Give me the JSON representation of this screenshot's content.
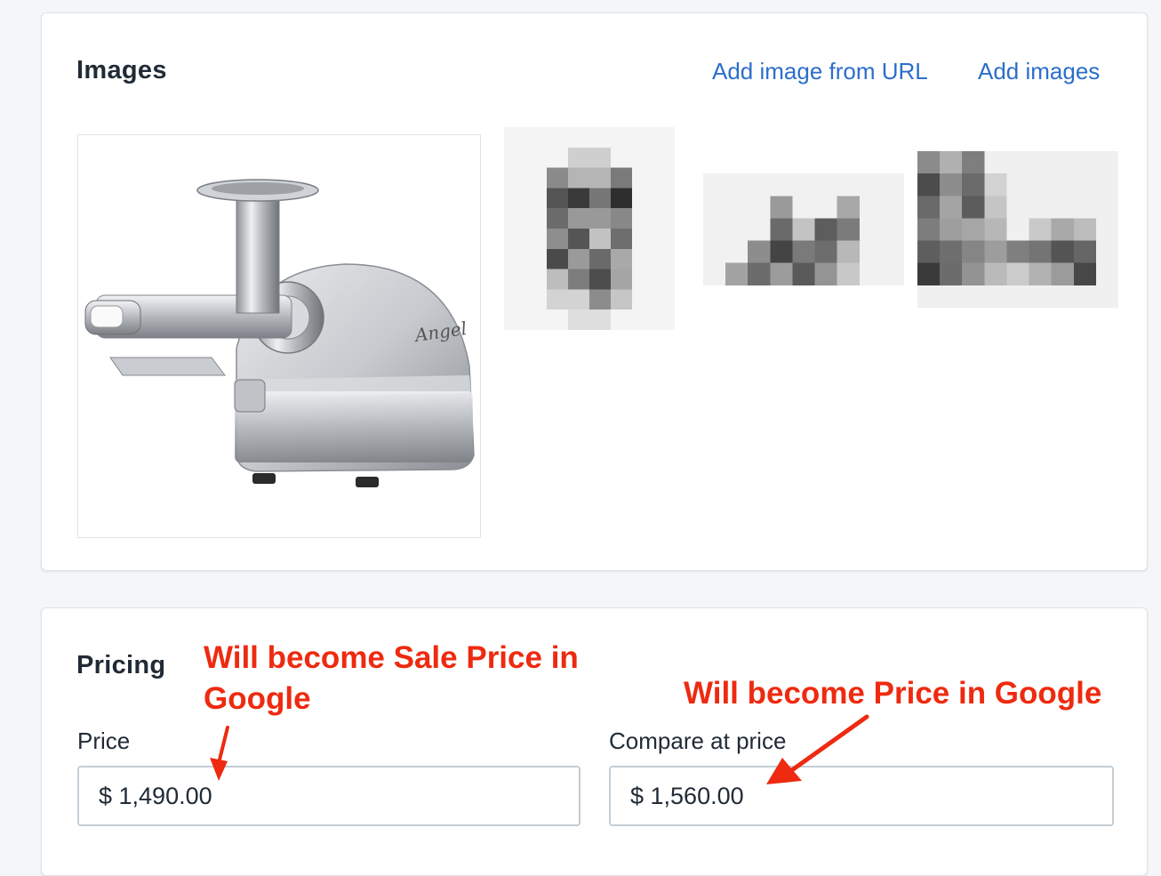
{
  "images_section": {
    "title": "Images",
    "add_from_url_label": "Add image from URL",
    "add_images_label": "Add images",
    "main_image_icon": "juicer-photo",
    "main_image_brand": "Angel",
    "thumbnails": [
      "pixelated-thumbnail-1",
      "pixelated-thumbnail-2",
      "pixelated-thumbnail-3"
    ]
  },
  "pricing_section": {
    "title": "Pricing",
    "price_label": "Price",
    "price_value": "$ 1,490.00",
    "compare_label": "Compare at price",
    "compare_value": "$ 1,560.00"
  },
  "annotations": {
    "sale_price_line1": "Will become Sale Price in",
    "sale_price_line2": "Google",
    "price_note": "Will become Price in Google"
  },
  "colors": {
    "link": "#2c6ecb",
    "annotation": "#ee2a10",
    "background": "#f4f6f8"
  }
}
